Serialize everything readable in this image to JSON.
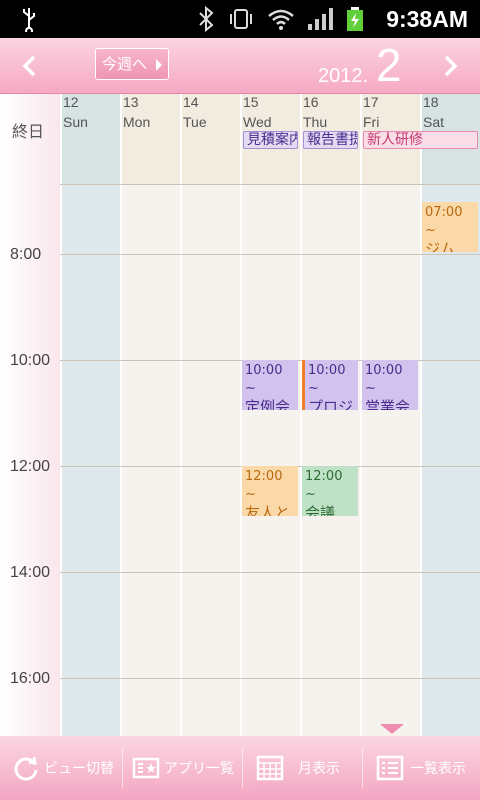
{
  "status": {
    "time": "9:38AM"
  },
  "header": {
    "today_label": "今週へ",
    "year": "2012.",
    "month": "2"
  },
  "calendar": {
    "allday_label": "終日",
    "hours": [
      "8:00",
      "10:00",
      "12:00",
      "14:00",
      "16:00"
    ],
    "days": [
      {
        "num": "12",
        "name": "Sun"
      },
      {
        "num": "13",
        "name": "Mon"
      },
      {
        "num": "14",
        "name": "Tue"
      },
      {
        "num": "15",
        "name": "Wed"
      },
      {
        "num": "16",
        "name": "Thu"
      },
      {
        "num": "17",
        "name": "Fri"
      },
      {
        "num": "18",
        "name": "Sat"
      }
    ],
    "allday_events": [
      {
        "title": "見積案内",
        "day": "Wed"
      },
      {
        "title": "報告書提出",
        "day": "Thu"
      },
      {
        "title": "新人研修",
        "day": "Fri-Sat"
      }
    ],
    "events": [
      {
        "time": "07:00 ~",
        "title": "ジム",
        "day": "Sat"
      },
      {
        "time": "10:00 ~",
        "title": "定例会議",
        "day": "Wed"
      },
      {
        "time": "10:00 ~",
        "title": "プロジェクト",
        "day": "Thu"
      },
      {
        "time": "10:00 ~",
        "title": "営業会議",
        "day": "Fri"
      },
      {
        "time": "12:00 ~",
        "title": "友人とランチ",
        "day": "Wed"
      },
      {
        "time": "12:00 ~",
        "title": "会議",
        "day": "Thu"
      }
    ]
  },
  "bottom": {
    "view_switch": "ビュー切替",
    "app_list": "アプリ一覧",
    "month_view": "月表示",
    "list_view": "一覧表示"
  },
  "colors": {
    "accent": "#f3a6c2",
    "event_purple": "#d2c3ee",
    "event_orange": "#fbd8a8",
    "event_green": "#bfe2c6"
  }
}
